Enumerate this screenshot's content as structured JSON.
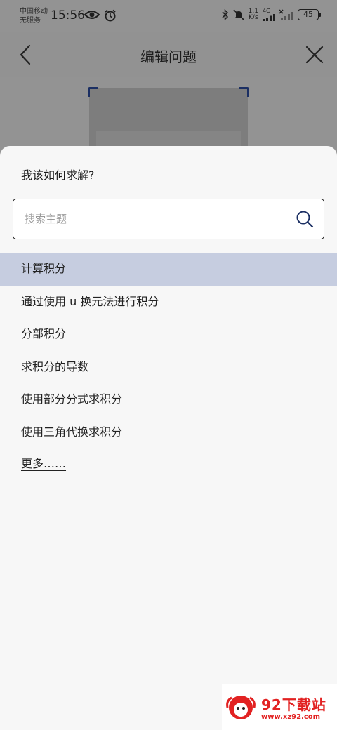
{
  "status_bar": {
    "carrier_line1": "中国移动",
    "carrier_line2": "无服务",
    "time": "15:56",
    "net_speed_value": "1.1",
    "net_speed_unit": "K/s",
    "network": "4G",
    "battery": "45"
  },
  "header": {
    "title": "编辑问题",
    "back_icon": "chevron-left-icon",
    "close_icon": "close-icon"
  },
  "sheet": {
    "title": "我该如何求解?",
    "search": {
      "value": "",
      "placeholder": "搜索主题",
      "icon": "search-icon"
    },
    "options": [
      {
        "label": "计算积分",
        "selected": true
      },
      {
        "label": "通过使用 u 换元法进行积分",
        "selected": false
      },
      {
        "label": "分部积分",
        "selected": false
      },
      {
        "label": "求积分的导数",
        "selected": false
      },
      {
        "label": "使用部分分式求积分",
        "selected": false
      },
      {
        "label": "使用三角代换求积分",
        "selected": false
      }
    ],
    "more_label": "更多……"
  },
  "watermark": {
    "name": "92下载站",
    "url": "www.xz92.com"
  },
  "colors": {
    "selected_bg": "#c6cde0",
    "accent": "#1b2f63",
    "watermark": "#e22222"
  }
}
